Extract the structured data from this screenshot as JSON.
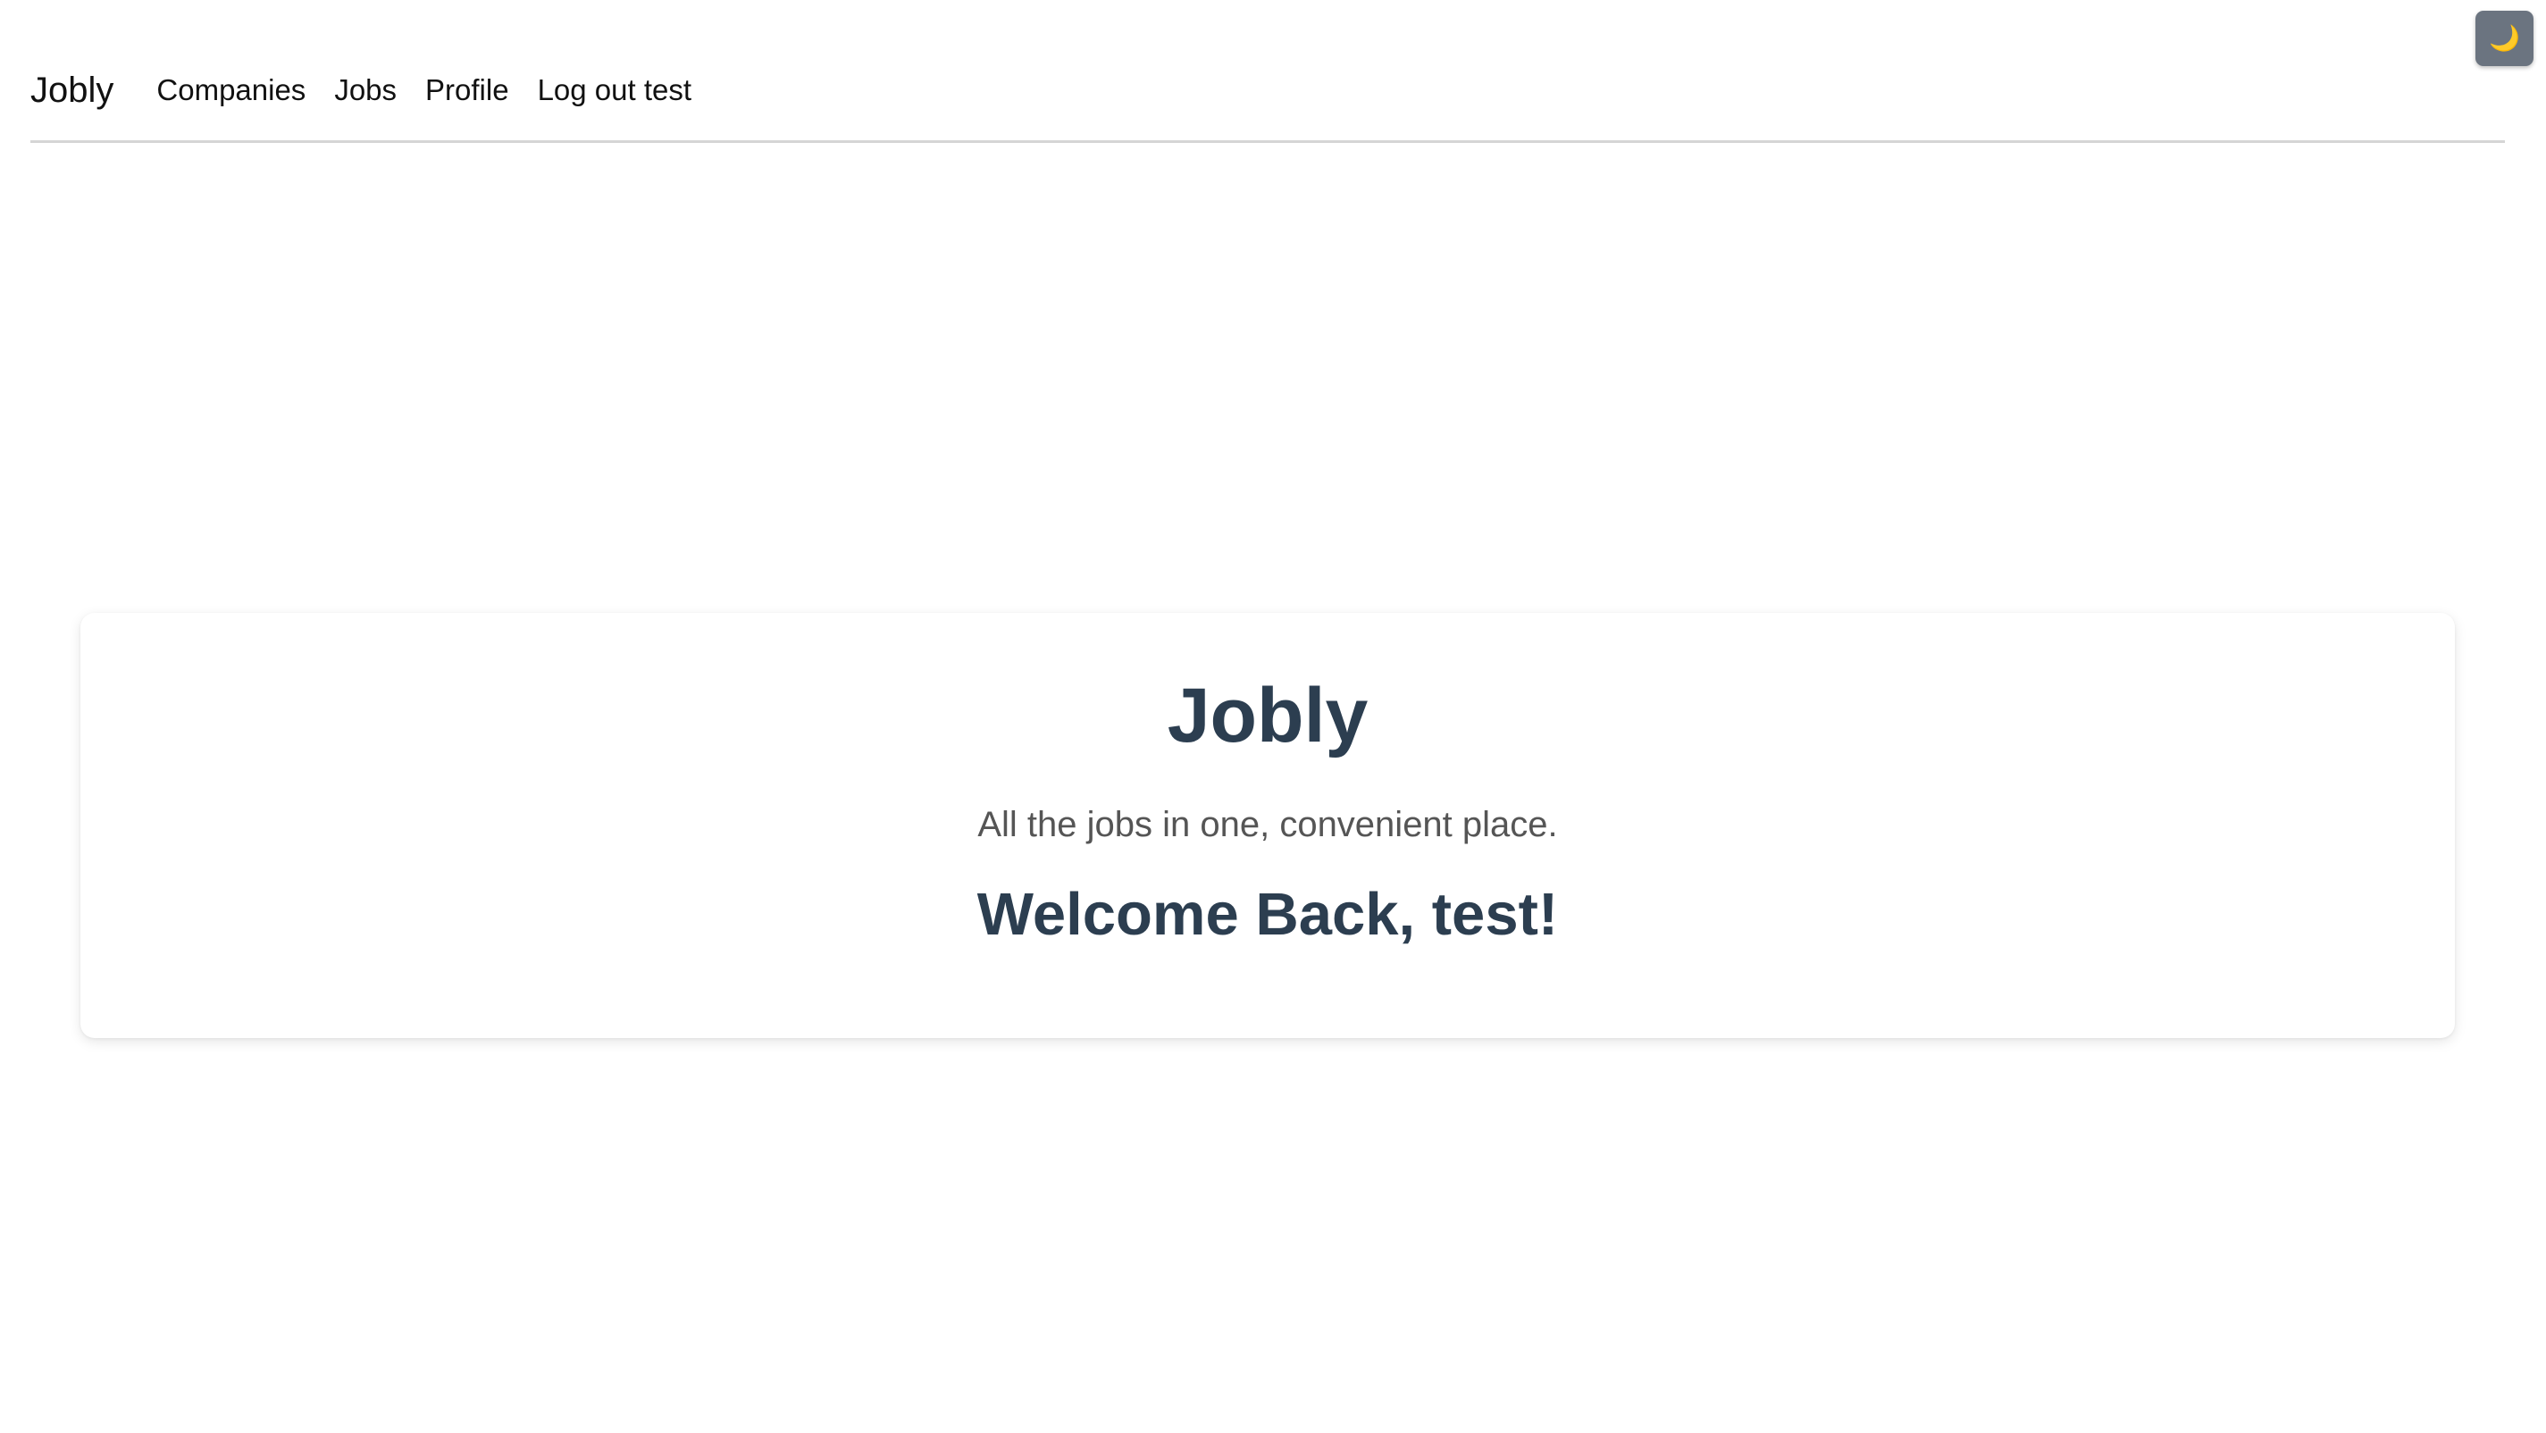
{
  "theme_toggle": {
    "icon": "moon-icon",
    "glyph": "🌙"
  },
  "navbar": {
    "brand": "Jobly",
    "links": [
      {
        "label": "Companies"
      },
      {
        "label": "Jobs"
      },
      {
        "label": "Profile"
      },
      {
        "label": "Log out test"
      }
    ]
  },
  "hero": {
    "title": "Jobly",
    "tagline": "All the jobs in one, convenient place.",
    "welcome": "Welcome Back, test!"
  },
  "colors": {
    "heading": "#2c3e50",
    "toggle_bg": "#6b7480",
    "divider": "#d5d5d5"
  }
}
